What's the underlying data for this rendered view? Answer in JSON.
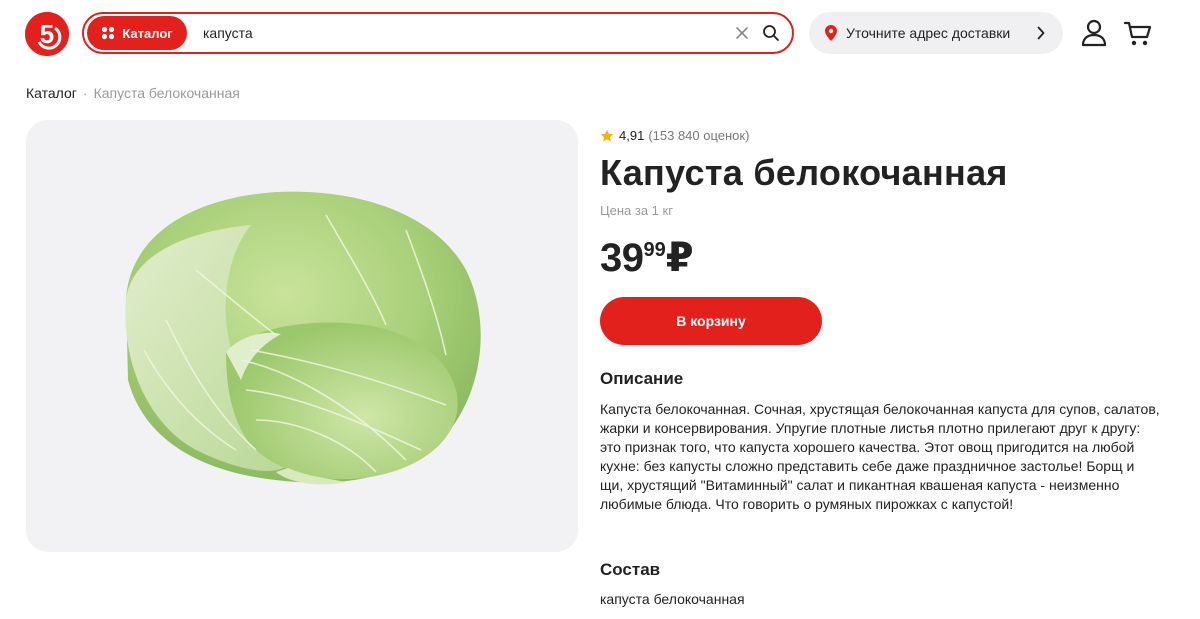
{
  "header": {
    "logo_text": "5",
    "catalog_label": "Каталог",
    "search_value": "капуста",
    "address_label": "Уточните адрес доставки"
  },
  "breadcrumb": {
    "root": "Каталог",
    "separator": "·",
    "current": "Капуста белокочанная"
  },
  "product": {
    "rating_value": "4,91",
    "rating_count": "(153 840 оценок)",
    "title": "Капуста белокочанная",
    "price_unit": "Цена за 1 кг",
    "price_rub": "39",
    "price_kop": "99",
    "currency": "₽",
    "add_to_cart_label": "В корзину",
    "description_heading": "Описание",
    "description": "Капуста белокочанная. Сочная, хрустящая белокочанная капуста для супов, салатов, жарки и консервирования. Упругие плотные листья плотно прилегают друг к другу: это признак того, что капуста хорошего качества. Этот овощ пригодится на любой кухне: без капусты сложно представить себе даже праздничное застолье! Борщ и щи, хрустящий \"Витаминный\" салат и пикантная квашеная капуста - неизменно любимые блюда. Что говорить о румяных пирожках с капустой!",
    "composition_heading": "Состав",
    "composition": "капуста белокочанная"
  },
  "icons": {
    "brand_color": "#e3211c",
    "catalog": "grid-dots-icon",
    "clear": "close-icon",
    "search": "search-icon",
    "location": "location-pin-icon",
    "chevron": "chevron-right-icon",
    "user": "user-icon",
    "cart": "cart-icon",
    "star": "star-icon"
  }
}
